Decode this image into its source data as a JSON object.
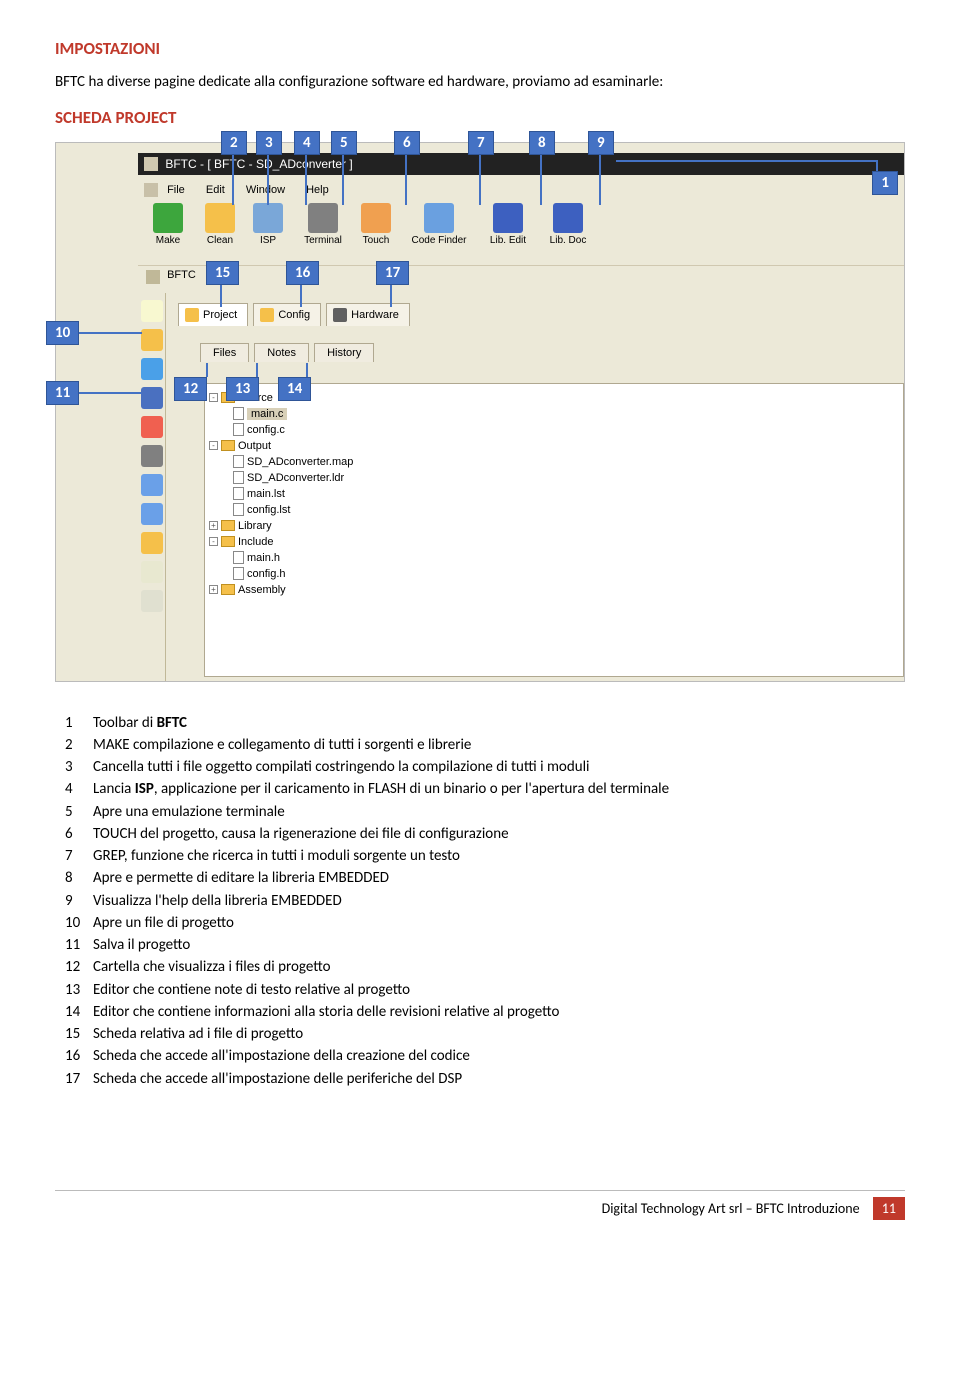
{
  "headings": {
    "h1": "IMPOSTAZIONI",
    "h2": "SCHEDA PROJECT"
  },
  "intro": "BFTC ha diverse pagine dedicate alla configurazione software ed hardware, proviamo ad esaminarle:",
  "app": {
    "title": "BFTC - [ BFTC - SD_ADconverter ]",
    "menu": [
      "File",
      "Edit",
      "Window",
      "Help"
    ],
    "toolbar": [
      "Make",
      "Clean",
      "ISP",
      "Terminal",
      "Touch",
      "Code Finder",
      "Lib. Edit",
      "Lib. Doc"
    ],
    "tbcolors": [
      "#3da63d",
      "#f5c04a",
      "#7aa7d8",
      "#808080",
      "#f0a050",
      "#6aa0e0",
      "#3d60c0",
      "#3d60c0"
    ],
    "bar2": "BFTC",
    "subtabs": [
      "Project",
      "Config",
      "Hardware"
    ],
    "subtabcolors": [
      "#f5c04a",
      "#f5c04a",
      "#606060"
    ],
    "subsubtabs": [
      "Files",
      "Notes",
      "History"
    ],
    "tree": {
      "root": "Source",
      "source": [
        "main.c",
        "config.c"
      ],
      "output": "Output",
      "outputFiles": [
        "SD_ADconverter.map",
        "SD_ADconverter.ldr",
        "main.lst",
        "config.lst"
      ],
      "library": "Library",
      "include": "Include",
      "includeFiles": [
        "main.h",
        "config.h"
      ],
      "assembly": "Assembly"
    },
    "vtcolors": [
      "#f8f8d0",
      "#f5c04a",
      "#4aa0e8",
      "#4a70c0",
      "#f06050",
      "#808080",
      "#6aa0e8",
      "#6aa0e8",
      "#f5c04a",
      "#e8e8d0",
      "#e0e0d0"
    ]
  },
  "badges": {
    "top": [
      "2",
      "3",
      "4",
      "5",
      "6",
      "7",
      "8",
      "9"
    ],
    "right": "1",
    "mid": [
      "15",
      "16",
      "17"
    ],
    "left": [
      "10",
      "11"
    ],
    "subsub": [
      "12",
      "13",
      "14"
    ]
  },
  "list": [
    {
      "n": "1",
      "t": "Toolbar di <b>BFTC</b>"
    },
    {
      "n": "2",
      "t": "MAKE compilazione e collegamento di tutti i sorgenti e librerie"
    },
    {
      "n": "3",
      "t": "Cancella tutti i file oggetto compilati costringendo la compilazione di tutti i moduli"
    },
    {
      "n": "4",
      "t": "Lancia <b>ISP</b>, applicazione per il caricamento in FLASH di un binario o per l'apertura del terminale"
    },
    {
      "n": "5",
      "t": "Apre una emulazione terminale"
    },
    {
      "n": "6",
      "t": "TOUCH del progetto, causa la rigenerazione dei file di configurazione"
    },
    {
      "n": "7",
      "t": "GREP, funzione che ricerca in tutti i moduli sorgente un testo"
    },
    {
      "n": "8",
      "t": "Apre e permette di editare la libreria EMBEDDED"
    },
    {
      "n": "9",
      "t": "Visualizza l'help della libreria EMBEDDED"
    },
    {
      "n": "10",
      "t": "Apre un file di progetto"
    },
    {
      "n": "11",
      "t": "Salva il progetto"
    },
    {
      "n": "12",
      "t": "Cartella che visualizza i files di progetto"
    },
    {
      "n": "13",
      "t": "Editor che contiene note di testo relative al progetto"
    },
    {
      "n": "14",
      "t": "Editor che contiene informazioni alla storia delle revisioni relative al progetto"
    },
    {
      "n": "15",
      "t": "Scheda relativa ad i file di progetto"
    },
    {
      "n": "16",
      "t": "Scheda che accede all'impostazione della creazione del codice"
    },
    {
      "n": "17",
      "t": "Scheda che accede all'impostazione delle periferiche del DSP"
    }
  ],
  "footer": {
    "left": "Digital Technology Art srl – BFTC Introduzione",
    "page": "11"
  }
}
